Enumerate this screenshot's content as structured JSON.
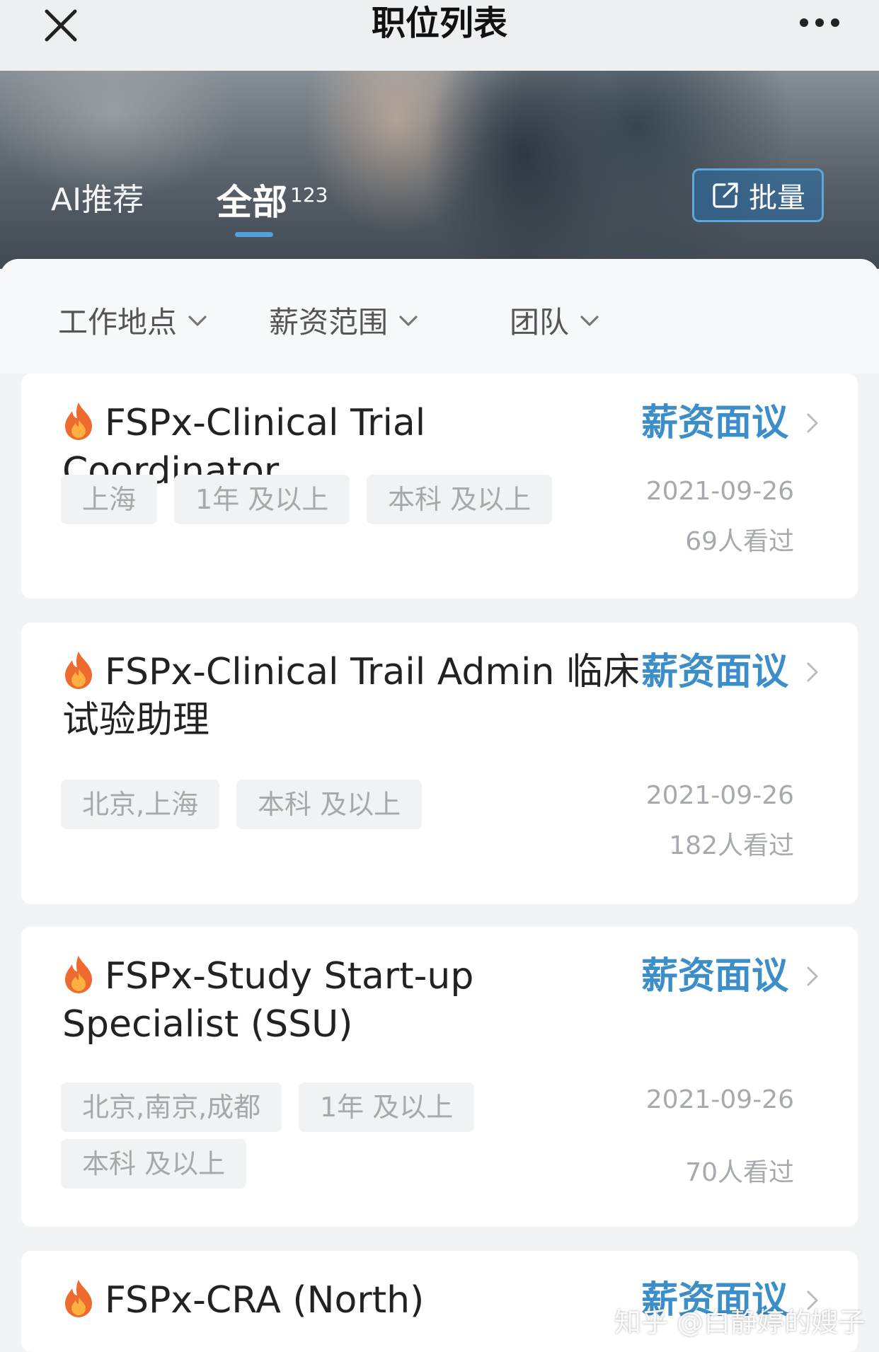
{
  "header": {
    "title": "职位列表"
  },
  "tabs": {
    "ai_label": "AI推荐",
    "all_label": "全部",
    "all_count": "123",
    "active": "all"
  },
  "batch_button": {
    "label": "批量"
  },
  "filters": {
    "location": "工作地点",
    "salary": "薪资范围",
    "team": "团队"
  },
  "jobs": [
    {
      "title": "FSPx-Clinical Trial Coordinator",
      "salary": "薪资面议",
      "tags": [
        "上海",
        "1年 及以上",
        "本科 及以上"
      ],
      "date": "2021-09-26",
      "views": "69人看过"
    },
    {
      "title": "FSPx-Clinical Trail Admin 临床试验助理",
      "salary": "薪资面议",
      "tags": [
        "北京,上海",
        "本科 及以上"
      ],
      "date": "2021-09-26",
      "views": "182人看过"
    },
    {
      "title": "FSPx-Study Start-up Specialist (SSU)",
      "salary": "薪资面议",
      "tags": [
        "北京,南京,成都",
        "1年 及以上",
        "本科 及以上"
      ],
      "date": "2021-09-26",
      "views": "70人看过"
    },
    {
      "title": "FSPx-CRA (North)",
      "salary": "薪资面议"
    }
  ],
  "watermark": "知乎 @白静婷的嫂子",
  "colors": {
    "accent": "#3c8ec8",
    "tab_indicator": "#4fa3dc",
    "tag_bg": "#f1f2f4",
    "muted_text": "#a6a9ae"
  },
  "icons": {
    "close": "close-icon",
    "more": "more-icon",
    "batch": "share-icon",
    "filter_arrow": "chevron-down-icon",
    "hot": "fire-icon",
    "row_arrow": "chevron-right-icon"
  }
}
